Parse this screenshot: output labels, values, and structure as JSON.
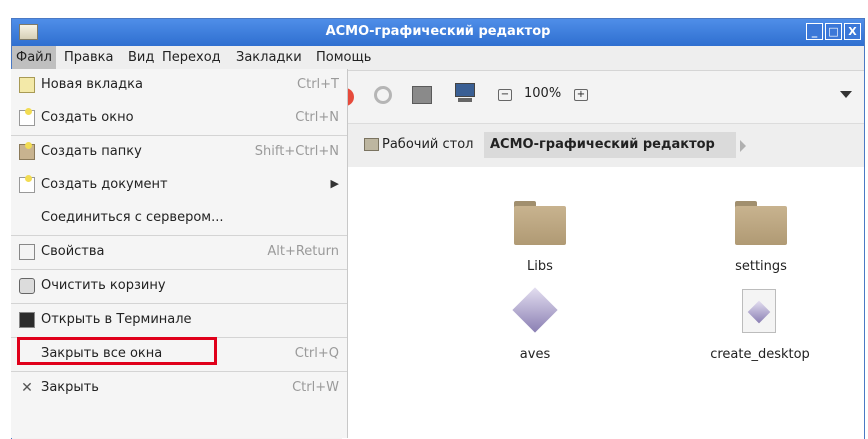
{
  "window": {
    "title": "АСМО-графический редактор",
    "controls": [
      "_",
      "□",
      "X"
    ]
  },
  "menubar": {
    "items": [
      "Файл",
      "Правка",
      "Вид",
      "Переход",
      "Закладки",
      "Помощь"
    ]
  },
  "file_menu": {
    "items": [
      {
        "label": "Новая вкладка",
        "accel": "Ctrl+T",
        "icon": "new-tab-icon"
      },
      {
        "label": "Создать окно",
        "accel": "Ctrl+N",
        "icon": "new-window-icon"
      },
      {
        "label": "Создать папку",
        "accel": "Shift+Ctrl+N",
        "icon": "new-folder-icon"
      },
      {
        "label": "Создать документ",
        "accel": "▶",
        "icon": "new-document-icon"
      },
      {
        "label": "Соединиться с сервером...",
        "accel": "",
        "icon": ""
      },
      {
        "label": "Свойства",
        "accel": "Alt+Return",
        "icon": "properties-icon"
      },
      {
        "label": "Очистить корзину",
        "accel": "",
        "icon": "trash-icon"
      },
      {
        "label": "Открыть в Терминале",
        "accel": "",
        "icon": "terminal-icon"
      },
      {
        "label": "Закрыть все окна",
        "accel": "Ctrl+Q",
        "icon": ""
      },
      {
        "label": "Закрыть",
        "accel": "Ctrl+W",
        "icon": "close-icon"
      }
    ]
  },
  "toolbar": {
    "zoom": "100%"
  },
  "location": {
    "crumbs": [
      "Рабочий стол",
      "АСМО-графический редактор"
    ]
  },
  "files": [
    {
      "name": "Libs",
      "type": "folder"
    },
    {
      "name": "settings",
      "type": "folder"
    },
    {
      "name": "aves",
      "type": "image"
    },
    {
      "name": "create_desktop",
      "type": "document"
    }
  ],
  "colors": {
    "titlebar": "#3c78d8",
    "highlight": "#e0001a",
    "folder": "#c8b38f"
  }
}
